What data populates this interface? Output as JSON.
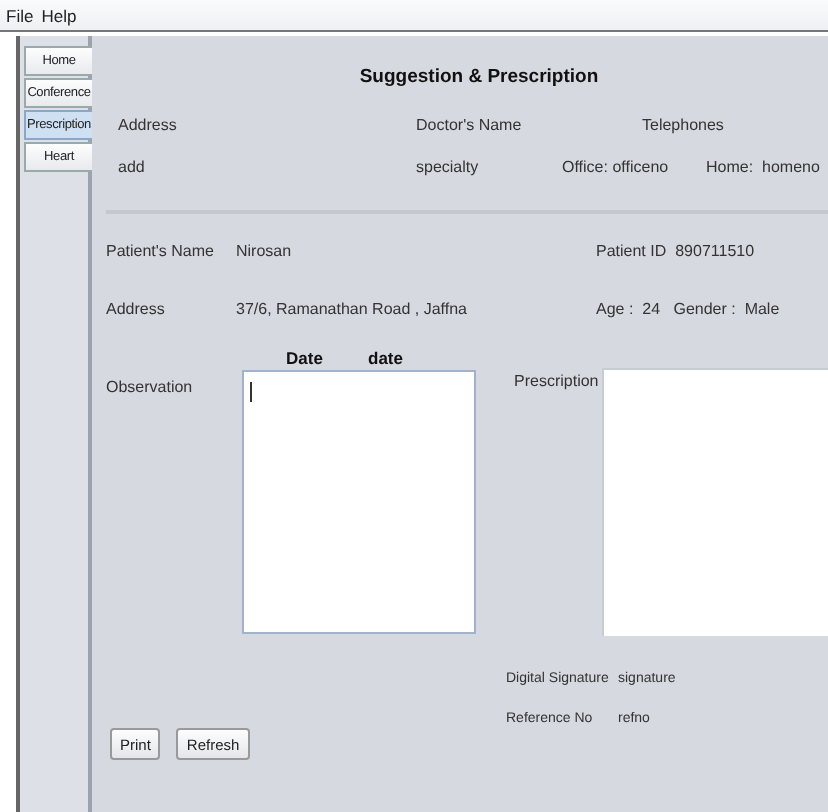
{
  "menu": [
    "File",
    "Help"
  ],
  "tabs": [
    {
      "label": "Home",
      "selected": false
    },
    {
      "label": "Conference",
      "selected": false
    },
    {
      "label": "Prescription",
      "selected": true
    },
    {
      "label": "Heart",
      "selected": false
    }
  ],
  "title": "Suggestion & Prescription",
  "doctor": {
    "address_label": "Address",
    "name_label": "Doctor's Name",
    "telephones_label": "Telephones",
    "address": "add",
    "specialty": "specialty",
    "office_label": "Office:",
    "office": "officeno",
    "home_label": "Home:",
    "home": "homeno"
  },
  "patient": {
    "name_label": "Patient's Name",
    "name": "Nirosan",
    "id_label": "Patient ID",
    "id": "890711510",
    "address_label": "Address",
    "address": "37/6, Ramanathan Road , Jaffna",
    "age_label": "Age :",
    "age": "24",
    "gender_label": "Gender :",
    "gender": "Male"
  },
  "date_label": "Date",
  "date": "date",
  "observation": {
    "label": "Observation"
  },
  "prescription": {
    "label": "Prescription"
  },
  "signature": {
    "label": "Digital Signature",
    "value": "signature"
  },
  "reference": {
    "label": "Reference No",
    "value": "refno"
  },
  "buttons": [
    "Print",
    "Refresh"
  ]
}
